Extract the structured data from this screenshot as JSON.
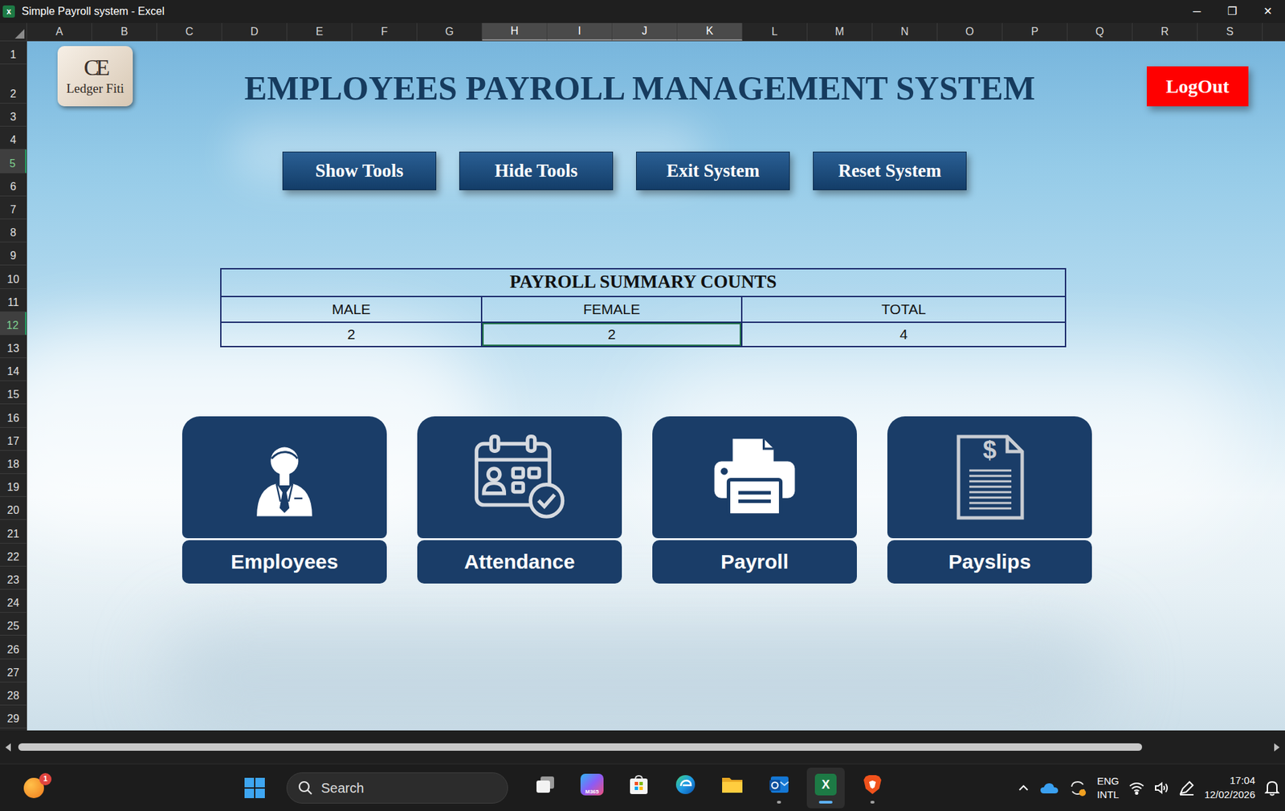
{
  "window": {
    "icon_glyph": "x",
    "title": "Simple Payroll system - Excel",
    "controls": [
      "─",
      "❐",
      "✕"
    ]
  },
  "sheet": {
    "columns": [
      {
        "label": "A",
        "selected": false
      },
      {
        "label": "B",
        "selected": false
      },
      {
        "label": "C",
        "selected": false
      },
      {
        "label": "D",
        "selected": false
      },
      {
        "label": "E",
        "selected": false
      },
      {
        "label": "F",
        "selected": false
      },
      {
        "label": "G",
        "selected": false
      },
      {
        "label": "H",
        "selected": true
      },
      {
        "label": "I",
        "selected": true
      },
      {
        "label": "J",
        "selected": true
      },
      {
        "label": "K",
        "selected": true
      },
      {
        "label": "L",
        "selected": false
      },
      {
        "label": "M",
        "selected": false
      },
      {
        "label": "N",
        "selected": false
      },
      {
        "label": "O",
        "selected": false
      },
      {
        "label": "P",
        "selected": false
      },
      {
        "label": "Q",
        "selected": false
      },
      {
        "label": "R",
        "selected": false
      },
      {
        "label": "S",
        "selected": false
      }
    ],
    "rows": [
      {
        "label": "1",
        "selected": false
      },
      {
        "label": "2",
        "selected": false
      },
      {
        "label": "3",
        "selected": false
      },
      {
        "label": "4",
        "selected": false
      },
      {
        "label": "5",
        "selected": true
      },
      {
        "label": "6",
        "selected": false
      },
      {
        "label": "7",
        "selected": false
      },
      {
        "label": "8",
        "selected": false
      },
      {
        "label": "9",
        "selected": false
      },
      {
        "label": "10",
        "selected": false
      },
      {
        "label": "11",
        "selected": false
      },
      {
        "label": "12",
        "selected": true
      },
      {
        "label": "13",
        "selected": false
      },
      {
        "label": "14",
        "selected": false
      },
      {
        "label": "15",
        "selected": false
      },
      {
        "label": "16",
        "selected": false
      },
      {
        "label": "17",
        "selected": false
      },
      {
        "label": "18",
        "selected": false
      },
      {
        "label": "19",
        "selected": false
      },
      {
        "label": "20",
        "selected": false
      },
      {
        "label": "21",
        "selected": false
      },
      {
        "label": "22",
        "selected": false
      },
      {
        "label": "23",
        "selected": false
      },
      {
        "label": "24",
        "selected": false
      },
      {
        "label": "25",
        "selected": false
      },
      {
        "label": "26",
        "selected": false
      },
      {
        "label": "27",
        "selected": false
      },
      {
        "label": "28",
        "selected": false
      },
      {
        "label": "29",
        "selected": false
      }
    ]
  },
  "dashboard": {
    "logo": {
      "monogram": "CE",
      "text": "Ledger Fiti"
    },
    "title": "EMPLOYEES PAYROLL MANAGEMENT SYSTEM",
    "logout": "LogOut",
    "tools": [
      "Show Tools",
      "Hide Tools",
      "Exit System",
      "Reset System"
    ],
    "summary": {
      "title": "PAYROLL SUMMARY COUNTS",
      "columns": [
        "MALE",
        "FEMALE",
        "TOTAL"
      ],
      "values": [
        {
          "text": "2",
          "selected": false
        },
        {
          "text": "2",
          "selected": true
        },
        {
          "text": "4",
          "selected": false
        }
      ]
    },
    "cards": [
      {
        "label": "Employees"
      },
      {
        "label": "Attendance"
      },
      {
        "label": "Payroll"
      },
      {
        "label": "Payslips",
        "glyph": "$"
      }
    ]
  },
  "taskbar": {
    "weather_badge": "1",
    "search": {
      "label": "Search"
    },
    "apps": [
      {
        "running": false,
        "active": false
      },
      {
        "glyph": "M365",
        "running": false,
        "active": false
      },
      {
        "running": false,
        "active": false
      },
      {
        "running": false,
        "active": false
      },
      {
        "running": false,
        "active": false
      },
      {
        "running": true,
        "active": false
      },
      {
        "glyph": "X",
        "running": true,
        "active": true
      },
      {
        "running": true,
        "active": false
      }
    ],
    "language": [
      "ENG",
      "INTL"
    ],
    "time": "17:04",
    "date": "12/02/2026"
  }
}
